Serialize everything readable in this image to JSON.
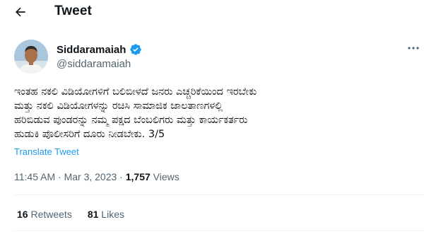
{
  "header": {
    "back_icon": "arrow-left-icon",
    "title": "Tweet"
  },
  "author": {
    "name": "Siddaramaiah",
    "handle": "@siddaramaiah",
    "verified_icon": "verified-badge-icon",
    "verified_color": "#1d9bf0"
  },
  "more_icon": "more-horizontal-icon",
  "tweet": {
    "text": "ಇಂತಹ ನಕಲಿ ವಿಡಿಯೋಗಳಿಗೆ ಬಲಿಬೀಳದೆ ಜನರು ಎಚ್ಚರಿಕೆಯಿಂದ ಇರಬೇಕು\nಮತ್ತು ನಕಲಿ ವಿಡಿಯೋಗಳನ್ನು ರಚಿಸಿ ಸಾಮಾಜಿಕ ಜಾಲತಾಣಗಳಲ್ಲಿ\nಹರಿಬಿಡುವ ಪುಂಡರನ್ನು ನಮ್ಮ ಪಕ್ಷದ ಬೆಂಬಲಿಗರು ಮತ್ತು ಕಾರ್ಯಕರ್ತರು\nಹುಡುಕಿ ಪೊಲೀಸರಿಗೆ ದೂರು ನೀಡಬೇಕು. 3/5",
    "translate_label": "Translate Tweet",
    "time": "11:45 AM",
    "separator": " · ",
    "date": "Mar 3, 2023",
    "views_count": "1,757",
    "views_label": " Views"
  },
  "stats": {
    "retweets_count": "16",
    "retweets_label": " Retweets",
    "likes_count": "81",
    "likes_label": " Likes"
  },
  "colors": {
    "link": "#1d9bf0",
    "secondary_text": "#536471",
    "primary_text": "#0f1419",
    "divider": "#eff3f4"
  }
}
